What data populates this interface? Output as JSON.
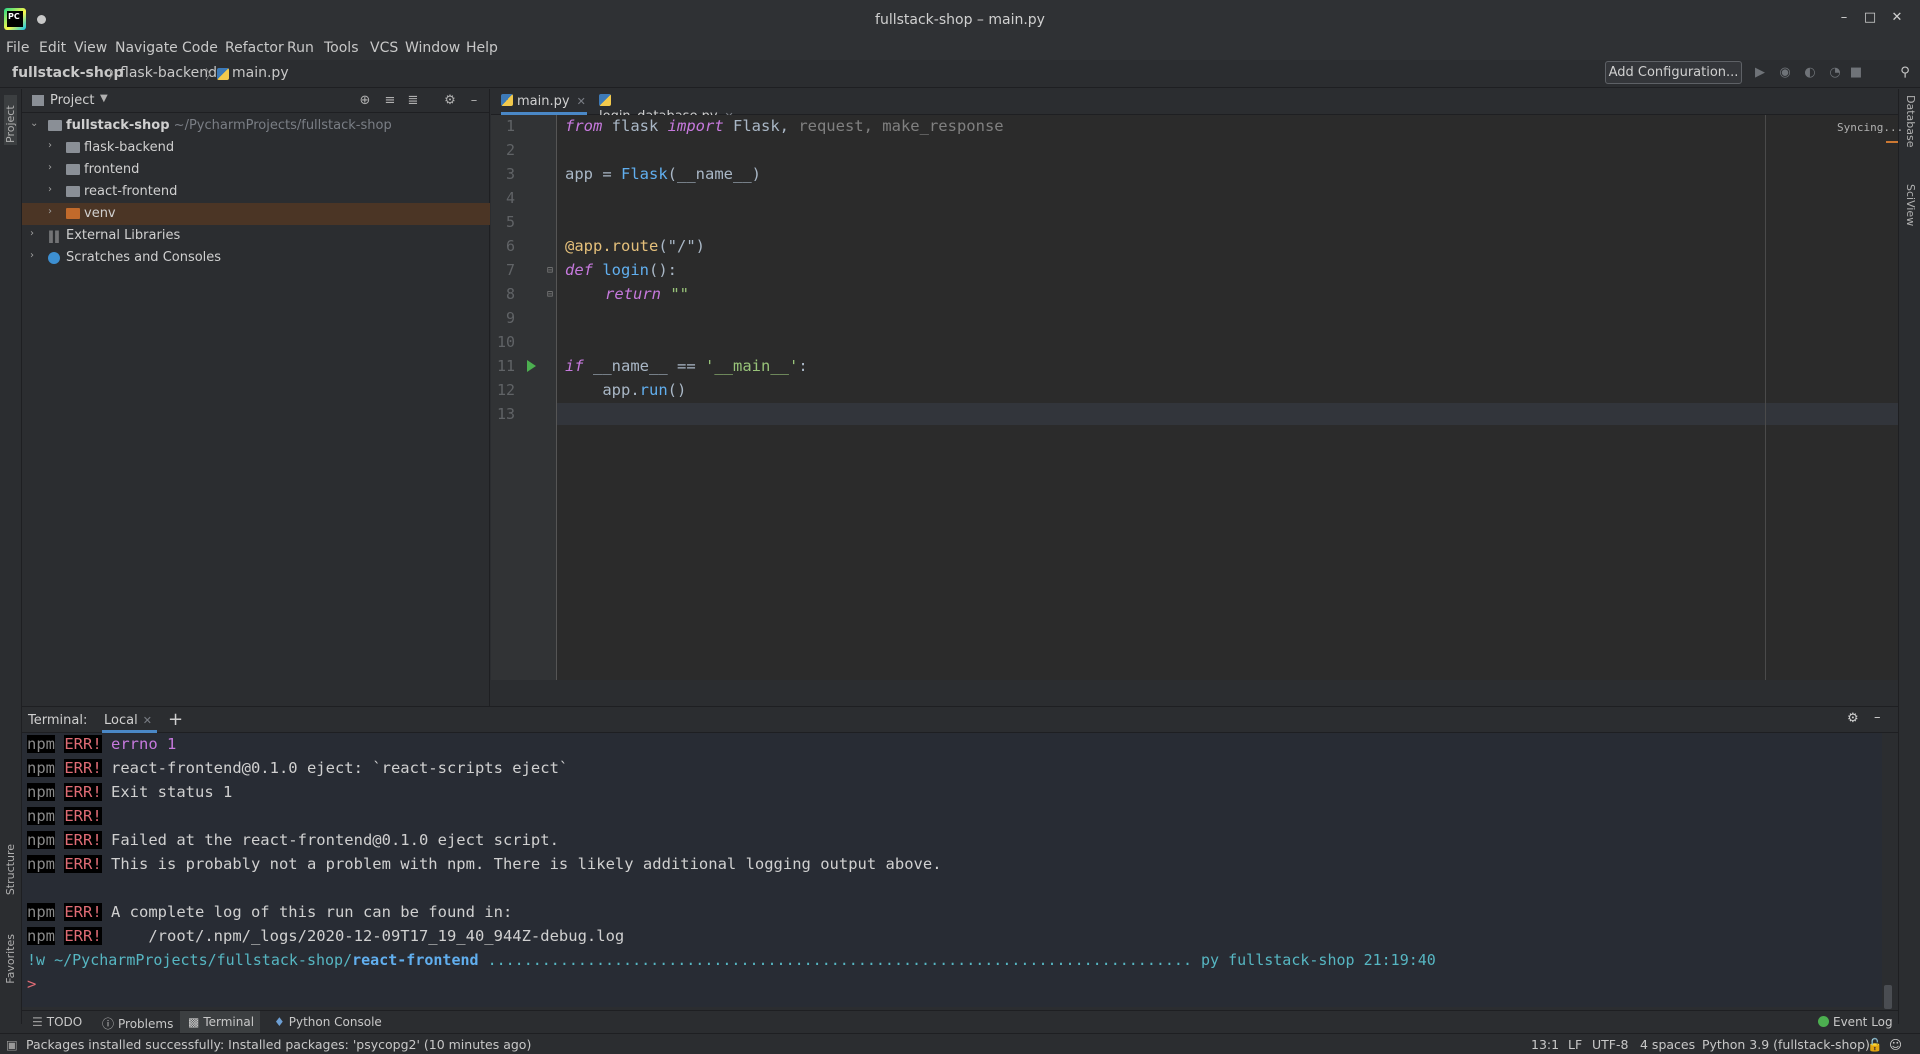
{
  "window": {
    "title": "fullstack-shop – main.py"
  },
  "menu": [
    "File",
    "Edit",
    "View",
    "Navigate",
    "Code",
    "Refactor",
    "Run",
    "Tools",
    "VCS",
    "Window",
    "Help"
  ],
  "breadcrumb": [
    "fullstack-shop",
    "flask-backend",
    "main.py"
  ],
  "toolbar": {
    "add_configuration": "Add Configuration..."
  },
  "left_strip": {
    "project": "Project",
    "structure": "Structure",
    "favorites": "Favorites"
  },
  "right_strip": {
    "database": "Database",
    "sciview": "SciView"
  },
  "project_panel": {
    "title": "Project",
    "tree": [
      {
        "label": "fullstack-shop",
        "path": "~/PycharmProjects/fullstack-shop"
      },
      {
        "label": "flask-backend"
      },
      {
        "label": "frontend"
      },
      {
        "label": "react-frontend"
      },
      {
        "label": "venv"
      },
      {
        "label": "External Libraries"
      },
      {
        "label": "Scratches and Consoles"
      }
    ]
  },
  "editor": {
    "tabs": [
      {
        "label": "main.py"
      },
      {
        "label": "login_database.py"
      }
    ],
    "status": "Syncing...",
    "line_numbers": [
      "1",
      "2",
      "3",
      "4",
      "5",
      "6",
      "7",
      "8",
      "9",
      "10",
      "11",
      "12",
      "13"
    ],
    "code": {
      "l1": {
        "kw1": "from",
        "mod": " flask ",
        "kw2": "import",
        "rest1": " Flask, ",
        "rest2": "request, make_response"
      },
      "l3": {
        "a": "app = ",
        "b": "Flask",
        "c": "(__name__)"
      },
      "l6": {
        "a": "@app.route",
        "b": "(\"/\")"
      },
      "l7": {
        "kw": "def",
        "fn": " login",
        "rest": "():"
      },
      "l8": {
        "kw": "return",
        "str": " \"\""
      },
      "l11": {
        "kw": "if",
        "a": " __name__ == ",
        "b": "'__main__'",
        "c": ":"
      },
      "l12": {
        "a": "    app.",
        "b": "run",
        "c": "()"
      }
    }
  },
  "terminal": {
    "label": "Terminal:",
    "tab": "Local",
    "npm": "npm",
    "err": "ERR!",
    "lines": [
      " errno 1",
      " react-frontend@0.1.0 eject: `react-scripts eject`",
      " Exit status 1",
      "",
      " Failed at the react-frontend@0.1.0 eject script.",
      " This is probably not a problem with npm. There is likely additional logging output above.",
      " A complete log of this run can be found in:",
      "     /root/.npm/_logs/2020-12-09T17_19_40_944Z-debug.log"
    ],
    "prompt": {
      "prefix": "!w",
      "path": " ~/PycharmProjects/fullstack-shop/",
      "dir": "react-frontend",
      "dots": " ..............................................................................",
      "right": " py fullstack-shop 21:19:40",
      "caret": ">"
    }
  },
  "tool_tabs": [
    "TODO",
    "Problems",
    "Terminal",
    "Python Console"
  ],
  "event_log": "Event Log",
  "status_bar": {
    "message": "Packages installed successfully: Installed packages: 'psycopg2' (10 minutes ago)",
    "position": "13:1",
    "line_sep": "LF",
    "encoding": "UTF-8",
    "indent": "4 spaces",
    "interpreter": "Python 3.9 (fullstack-shop)"
  }
}
